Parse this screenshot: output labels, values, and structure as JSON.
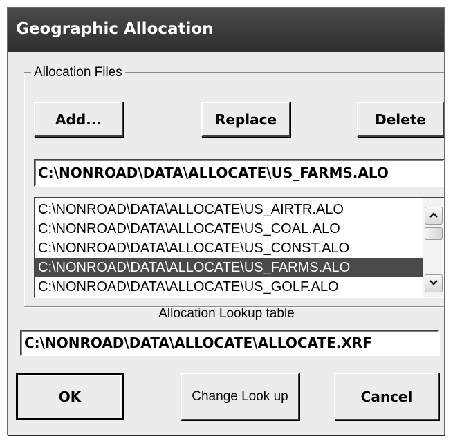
{
  "window": {
    "title": "Geographic Allocation"
  },
  "allocation_files": {
    "group_label": "Allocation Files",
    "add_label": "Add...",
    "replace_label": "Replace",
    "delete_label": "Delete",
    "current_file": "C:\\NONROAD\\DATA\\ALLOCATE\\US_FARMS.ALO",
    "files": [
      {
        "path": "C:\\NONROAD\\DATA\\ALLOCATE\\US_AIRTR.ALO",
        "selected": false
      },
      {
        "path": "C:\\NONROAD\\DATA\\ALLOCATE\\US_COAL.ALO",
        "selected": false
      },
      {
        "path": "C:\\NONROAD\\DATA\\ALLOCATE\\US_CONST.ALO",
        "selected": false
      },
      {
        "path": "C:\\NONROAD\\DATA\\ALLOCATE\\US_FARMS.ALO",
        "selected": true
      },
      {
        "path": "C:\\NONROAD\\DATA\\ALLOCATE\\US_GOLF.ALO",
        "selected": false
      }
    ]
  },
  "lookup": {
    "caption": "Allocation Lookup table",
    "path": "C:\\NONROAD\\DATA\\ALLOCATE\\ALLOCATE.XRF"
  },
  "footer": {
    "ok_label": "OK",
    "change_label": "Change Look up",
    "cancel_label": "Cancel"
  },
  "icons": {
    "scroll_up": "chevron-up-icon",
    "scroll_down": "chevron-down-icon"
  },
  "colors": {
    "titlebar": "#3a3a3a",
    "selection": "#4a4a4a",
    "dialog_bg": "#ececec"
  }
}
